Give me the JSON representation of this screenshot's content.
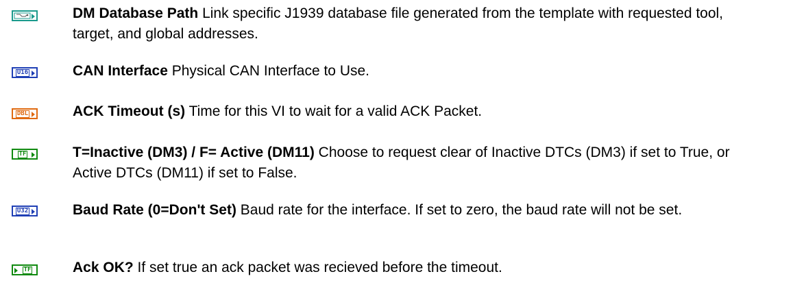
{
  "colors": {
    "path": "#1a9a8c",
    "integer": "#1f3fb5",
    "double": "#e06a10",
    "boolean": "#108a10"
  },
  "items": [
    {
      "icon": "path-terminal-icon",
      "icon_label": "",
      "name": "DM Database Path",
      "description": "Link specific J1939 database file generated from the template with requested tool, target, and global addresses."
    },
    {
      "icon": "u16-terminal-icon",
      "icon_label": "U16",
      "name": "CAN Interface",
      "description": "Physical CAN Interface to Use."
    },
    {
      "icon": "dbl-terminal-icon",
      "icon_label": "DBL",
      "name": "ACK Timeout (s)",
      "description": "Time for this VI to wait for a valid ACK Packet."
    },
    {
      "icon": "tf-terminal-icon",
      "icon_label": "TF",
      "name": "T=Inactive (DM3) / F= Active (DM11)",
      "description": "Choose to request clear of Inactive DTCs (DM3) if set to True, or Active DTCs (DM11) if set to False."
    },
    {
      "icon": "u32-terminal-icon",
      "icon_label": "U32",
      "name": "Baud Rate (0=Don't Set)",
      "description": "Baud rate for the interface.  If set to zero, the baud rate will not be set."
    },
    {
      "icon": "tf-output-terminal-icon",
      "icon_label": "TF",
      "name": "Ack OK?",
      "description": "If set true an ack packet was recieved before the timeout."
    }
  ]
}
